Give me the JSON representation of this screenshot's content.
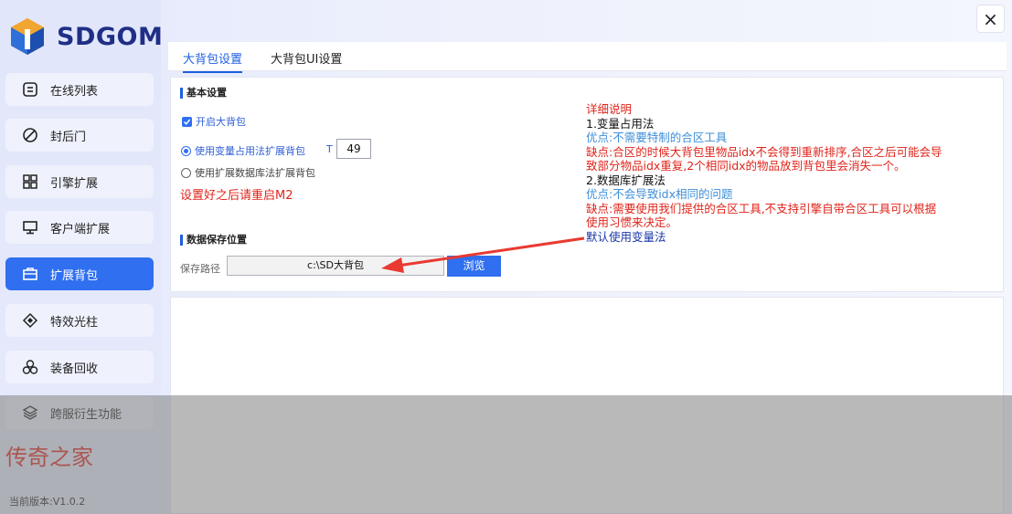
{
  "app": {
    "logo_text": "SDGOM",
    "close_label": "×",
    "version": "当前版本:V1.0.2",
    "brand_note": "传奇之家"
  },
  "sidebar": {
    "items": [
      {
        "label": "在线列表",
        "icon": "list-icon"
      },
      {
        "label": "封后门",
        "icon": "block-icon"
      },
      {
        "label": "引擎扩展",
        "icon": "grid-icon"
      },
      {
        "label": "客户端扩展",
        "icon": "monitor-icon"
      },
      {
        "label": "扩展背包",
        "icon": "bag-icon",
        "active": true
      },
      {
        "label": "特效光柱",
        "icon": "diamond-icon"
      },
      {
        "label": "装备回收",
        "icon": "recycle-icon"
      },
      {
        "label": "跨服衍生功能",
        "icon": "layers-icon"
      }
    ]
  },
  "tabs": [
    {
      "label": "大背包设置",
      "active": true
    },
    {
      "label": "大背包UI设置",
      "active": false
    }
  ],
  "basic": {
    "title": "基本设置",
    "enable_label": "开启大背包",
    "enable_checked": true,
    "radio1_label": "使用变量占用法扩展背包",
    "radio1_selected": true,
    "t_label": "T",
    "t_value": "49",
    "radio2_label": "使用扩展数据库法扩展背包",
    "radio2_selected": false,
    "restart_note": "设置好之后请重启M2"
  },
  "storage": {
    "title": "数据保存位置",
    "path_label": "保存路径",
    "path_value": "c:\\SD大背包",
    "browse_label": "浏览"
  },
  "description": {
    "heading": "详细说明",
    "m1_title": "1.变量占用法",
    "m1_pro": "优点:不需要特制的合区工具",
    "m1_con_1": "缺点:合区的时候大背包里物品idx不会得到重新排序,合区之后可能会导",
    "m1_con_2": "致部分物品idx重复,2个相同idx的物品放到背包里会消失一个。",
    "m2_title": "2.数据库扩展法",
    "m2_pro": "优点:不会导致idx相同的问题",
    "m2_con_1": "缺点:需要使用我们提供的合区工具,不支持引擎自带合区工具可以根据",
    "m2_con_2": "使用习惯来决定。",
    "default_note": "默认使用变量法"
  },
  "colors": {
    "accent": "#2f6ff0",
    "warning": "#e0241b",
    "info": "#3f8fd8",
    "logo": "#1f2f86"
  }
}
